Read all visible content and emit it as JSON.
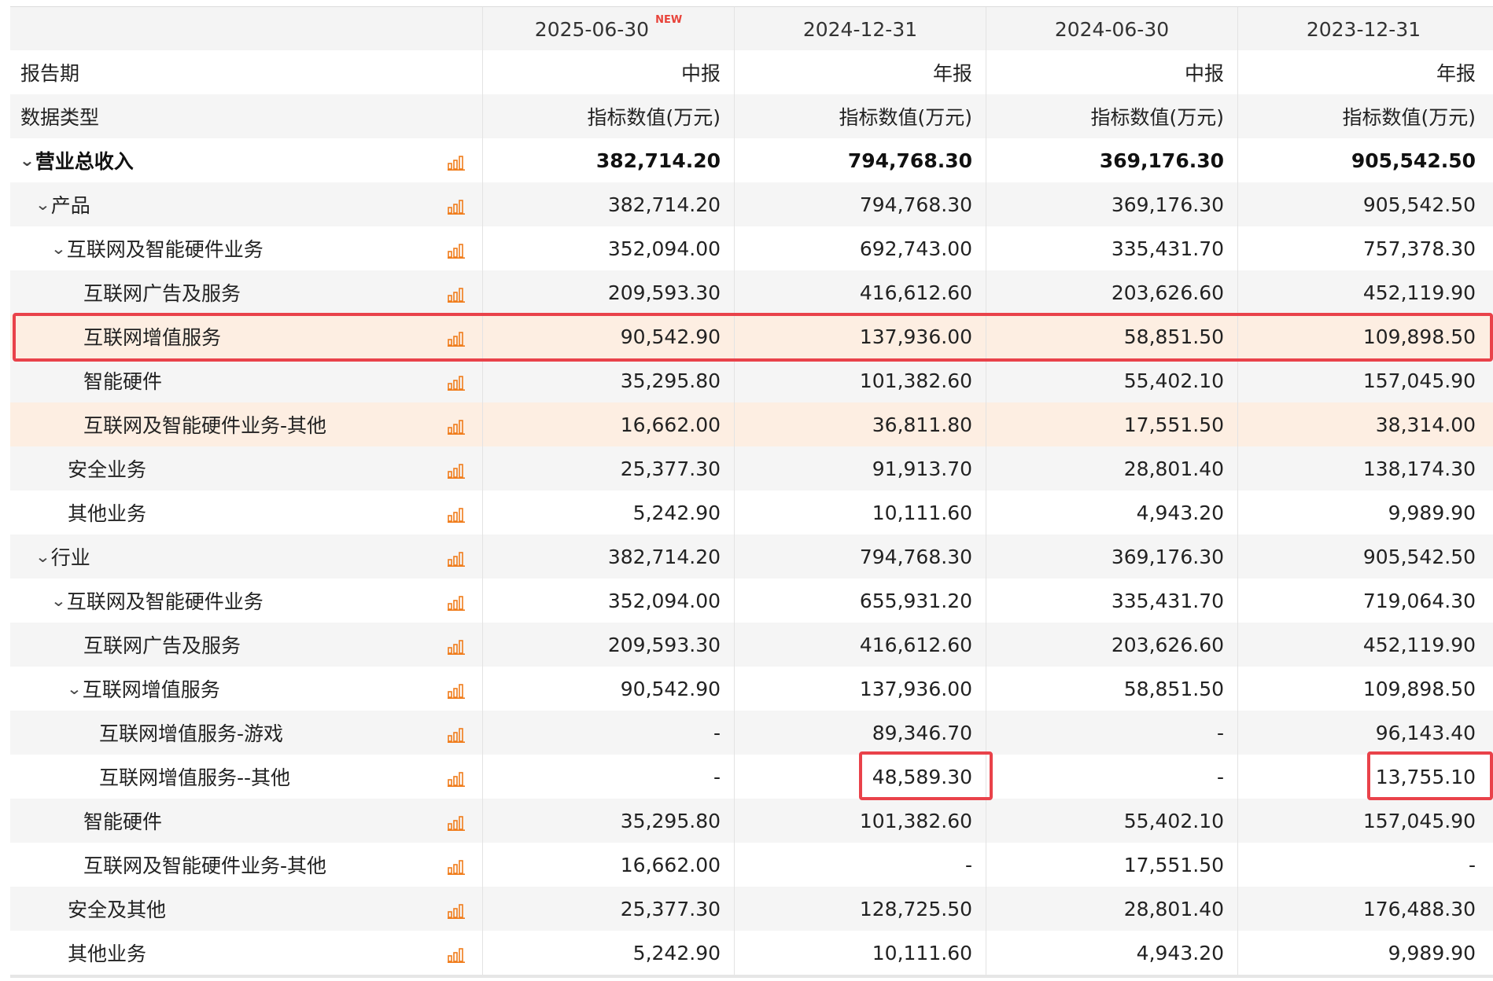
{
  "header": {
    "columns": [
      {
        "date": "2025-06-30",
        "badge": "NEW"
      },
      {
        "date": "2024-12-31",
        "badge": ""
      },
      {
        "date": "2024-06-30",
        "badge": ""
      },
      {
        "date": "2023-12-31",
        "badge": ""
      }
    ]
  },
  "meta_rows": [
    {
      "label": "报告期",
      "values": [
        "中报",
        "年报",
        "中报",
        "年报"
      ]
    },
    {
      "label": "数据类型",
      "values": [
        "指标数值(万元)",
        "指标数值(万元)",
        "指标数值(万元)",
        "指标数值(万元)"
      ]
    }
  ],
  "rows": [
    {
      "label": "营业总收入",
      "level": 0,
      "expandable": true,
      "bold": true,
      "values": [
        "382,714.20",
        "794,768.30",
        "369,176.30",
        "905,542.50"
      ]
    },
    {
      "label": "产品",
      "level": 1,
      "expandable": true,
      "values": [
        "382,714.20",
        "794,768.30",
        "369,176.30",
        "905,542.50"
      ]
    },
    {
      "label": "互联网及智能硬件业务",
      "level": 2,
      "expandable": true,
      "values": [
        "352,094.00",
        "692,743.00",
        "335,431.70",
        "757,378.30"
      ]
    },
    {
      "label": "互联网广告及服务",
      "level": 3,
      "values": [
        "209,593.30",
        "416,612.60",
        "203,626.60",
        "452,119.90"
      ]
    },
    {
      "label": "互联网增值服务",
      "level": 3,
      "highlight": true,
      "values": [
        "90,542.90",
        "137,936.00",
        "58,851.50",
        "109,898.50"
      ]
    },
    {
      "label": "智能硬件",
      "level": 3,
      "values": [
        "35,295.80",
        "101,382.60",
        "55,402.10",
        "157,045.90"
      ]
    },
    {
      "label": "互联网及智能硬件业务-其他",
      "level": 3,
      "values": [
        "16,662.00",
        "36,811.80",
        "17,551.50",
        "38,314.00"
      ]
    },
    {
      "label": "安全业务",
      "level": 2,
      "values": [
        "25,377.30",
        "91,913.70",
        "28,801.40",
        "138,174.30"
      ]
    },
    {
      "label": "其他业务",
      "level": 2,
      "values": [
        "5,242.90",
        "10,111.60",
        "4,943.20",
        "9,989.90"
      ]
    },
    {
      "label": "行业",
      "level": 1,
      "expandable": true,
      "values": [
        "382,714.20",
        "794,768.30",
        "369,176.30",
        "905,542.50"
      ]
    },
    {
      "label": "互联网及智能硬件业务",
      "level": 2,
      "expandable": true,
      "values": [
        "352,094.00",
        "655,931.20",
        "335,431.70",
        "719,064.30"
      ]
    },
    {
      "label": "互联网广告及服务",
      "level": 3,
      "values": [
        "209,593.30",
        "416,612.60",
        "203,626.60",
        "452,119.90"
      ]
    },
    {
      "label": "互联网增值服务",
      "level": 3,
      "expandable": true,
      "values": [
        "90,542.90",
        "137,936.00",
        "58,851.50",
        "109,898.50"
      ]
    },
    {
      "label": "互联网增值服务-游戏",
      "level": 4,
      "values": [
        "-",
        "89,346.70",
        "-",
        "96,143.40"
      ]
    },
    {
      "label": "互联网增值服务--其他",
      "level": 4,
      "values": [
        "-",
        "48,589.30",
        "-",
        "13,755.10"
      ]
    },
    {
      "label": "智能硬件",
      "level": 3,
      "values": [
        "35,295.80",
        "101,382.60",
        "55,402.10",
        "157,045.90"
      ]
    },
    {
      "label": "互联网及智能硬件业务-其他",
      "level": 3,
      "values": [
        "16,662.00",
        "-",
        "17,551.50",
        "-"
      ]
    },
    {
      "label": "安全及其他",
      "level": 2,
      "values": [
        "25,377.30",
        "128,725.50",
        "28,801.40",
        "176,488.30"
      ]
    },
    {
      "label": "其他业务",
      "level": 2,
      "values": [
        "5,242.90",
        "10,111.60",
        "4,943.20",
        "9,989.90"
      ]
    }
  ],
  "colors": {
    "accent_orange": "#f07c1b",
    "highlight_red": "#e9424a",
    "highlight_fill": "#fdeee2",
    "new_badge": "#e8433a"
  },
  "icons": {
    "expand": "chevron-down-icon",
    "chart": "bar-chart-icon"
  }
}
